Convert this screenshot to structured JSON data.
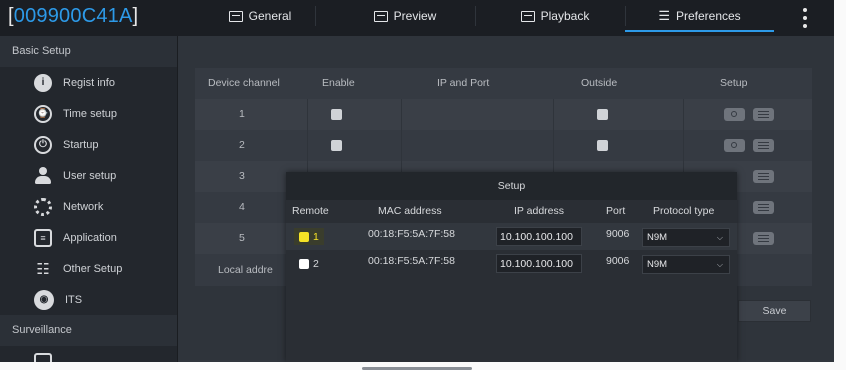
{
  "header": {
    "device_id": "009900C41A",
    "tabs": [
      {
        "label": "General",
        "icon": "table-icon",
        "active": false
      },
      {
        "label": "Preview",
        "icon": "eye-monitor-icon",
        "active": false
      },
      {
        "label": "Playback",
        "icon": "film-icon",
        "active": false
      },
      {
        "label": "Preferences",
        "icon": "sliders-icon",
        "active": true
      }
    ],
    "accent_color": "#2d9ae8"
  },
  "sidebar": {
    "sections": [
      {
        "title": "Basic Setup",
        "items": [
          {
            "label": "Regist info",
            "icon": "info-icon"
          },
          {
            "label": "Time setup",
            "icon": "clock-icon"
          },
          {
            "label": "Startup",
            "icon": "power-icon"
          },
          {
            "label": "User setup",
            "icon": "user-icon"
          },
          {
            "label": "Network",
            "icon": "network-gear-icon"
          },
          {
            "label": "Application",
            "icon": "application-icon"
          },
          {
            "label": "Other Setup",
            "icon": "other-setup-icon"
          },
          {
            "label": "ITS",
            "icon": "steering-wheel-icon"
          }
        ]
      },
      {
        "title": "Surveillance",
        "items": []
      }
    ]
  },
  "channel_table": {
    "headers": [
      "Device channel",
      "Enable",
      "IP and Port",
      "Outside",
      "Setup"
    ],
    "rows": [
      {
        "channel": "1"
      },
      {
        "channel": "2"
      },
      {
        "channel": "3"
      },
      {
        "channel": "4"
      },
      {
        "channel": "5"
      }
    ],
    "local_label": "Local addre",
    "save_label": "Save"
  },
  "setup_dialog": {
    "title": "Setup",
    "headers": [
      "Remote",
      "MAC address",
      "IP address",
      "Port",
      "Protocol type"
    ],
    "rows": [
      {
        "remote": "1",
        "checked_highlight": true,
        "mac": "00:18:F5:5A:7F:58",
        "ip": "10.100.100.100",
        "port": "9006",
        "protocol": "N9M"
      },
      {
        "remote": "2",
        "checked_highlight": false,
        "mac": "00:18:F5:5A:7F:58",
        "ip": "10.100.100.100",
        "port": "9006",
        "protocol": "N9M"
      }
    ],
    "highlight_color": "#f6e326"
  }
}
